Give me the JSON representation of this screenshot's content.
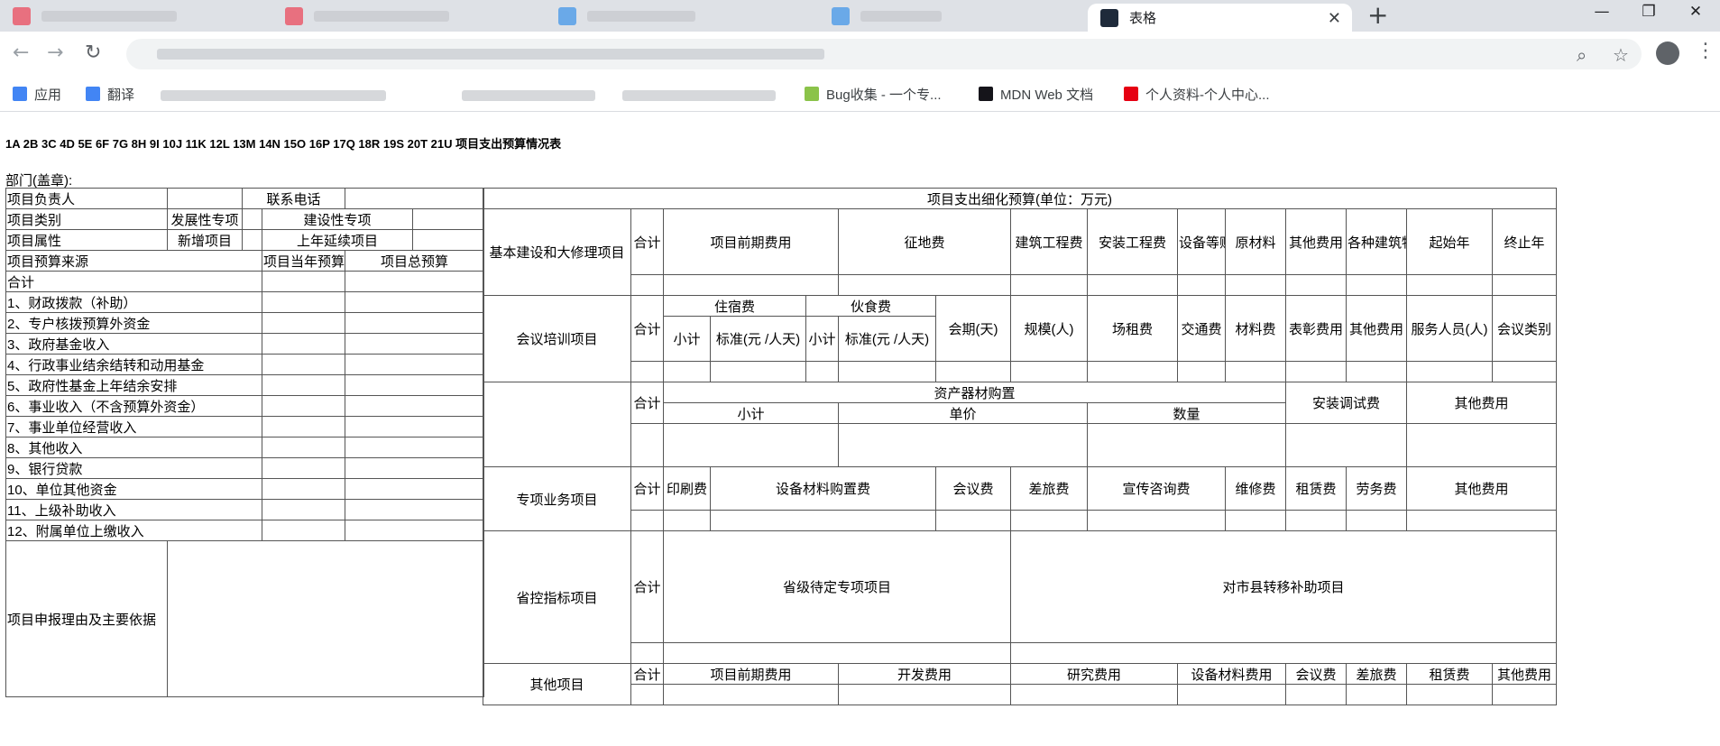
{
  "browser": {
    "active_tab_title": "表格",
    "bookmarks": [
      "应用",
      "翻译",
      "Bug收集 - 一个专...",
      "MDN Web 文档",
      "个人资料-个人中心..."
    ]
  },
  "page": {
    "heading": "1A 2B 3C 4D 5E 6F 7G 8H 9I 10J 11K 12L 13M 14N 15O 16P 17Q 18R 19S 20T 21U 项目支出预算情况表",
    "dept_label": "部门(盖章):"
  },
  "left": {
    "head_rows": [
      [
        "项目负责人",
        "",
        "联系电话",
        ""
      ],
      [
        "项目类别",
        "发展性专项",
        "",
        "建设性专项",
        ""
      ],
      [
        "项目属性",
        "新增项目",
        "",
        "上年延续项目",
        ""
      ]
    ],
    "source_headers": [
      "项目预算来源",
      "项目当年预算",
      "项目总预算"
    ],
    "sources": [
      "合计",
      "1、财政拨款（补助）",
      "2、专户核拨预算外资金",
      "3、政府基金收入",
      "4、行政事业结余结转和动用基金",
      "5、政府性基金上年结余安排",
      "6、事业收入（不含预算外资金）",
      "7、事业单位经营收入",
      "8、其他收入",
      "9、银行贷款",
      "10、单位其他资金",
      "11、上级补助收入",
      "12、附属单位上缴收入"
    ],
    "reason_label": "项目申报理由及主要依据"
  },
  "right": {
    "title": "项目支出细化预算(单位：万元)",
    "total_label": "合计",
    "construction": {
      "label": "基本建设和大修理项目",
      "cols": [
        "项目前期费用",
        "征地费",
        "建筑工程费",
        "安装工程费",
        "设备等购置费",
        "原材料",
        "其他费用",
        "各种建筑物面积",
        "起始年",
        "终止年"
      ]
    },
    "meeting": {
      "label": "会议培训项目",
      "lodging": "住宿费",
      "meals": "伙食费",
      "subtotal": "小计",
      "standard": "标准(元 /人天)",
      "cols": [
        "会期(天)",
        "规模(人)",
        "场租费",
        "交通费",
        "材料费",
        "表彰费用",
        "其他费用",
        "服务人员(人)",
        "会议类别"
      ]
    },
    "equipment": {
      "purchase": "资产器材购置",
      "subtotal": "小计",
      "unit_price": "单价",
      "quantity": "数量",
      "install": "安装调试费",
      "other": "其他费用"
    },
    "special": {
      "label": "专项业务项目",
      "cols": [
        "印刷费",
        "设备材料购置费",
        "会议费",
        "差旅费",
        "宣传咨询费",
        "维修费",
        "租赁费",
        "劳务费",
        "其他费用"
      ]
    },
    "provincial": {
      "label": "省控指标项目",
      "cols": [
        "省级待定专项项目",
        "对市县转移补助项目"
      ]
    },
    "other": {
      "label": "其他项目",
      "cols": [
        "项目前期费用",
        "开发费用",
        "研究费用",
        "设备材料费用",
        "会议费",
        "差旅费",
        "租赁费",
        "其他费用"
      ]
    }
  }
}
